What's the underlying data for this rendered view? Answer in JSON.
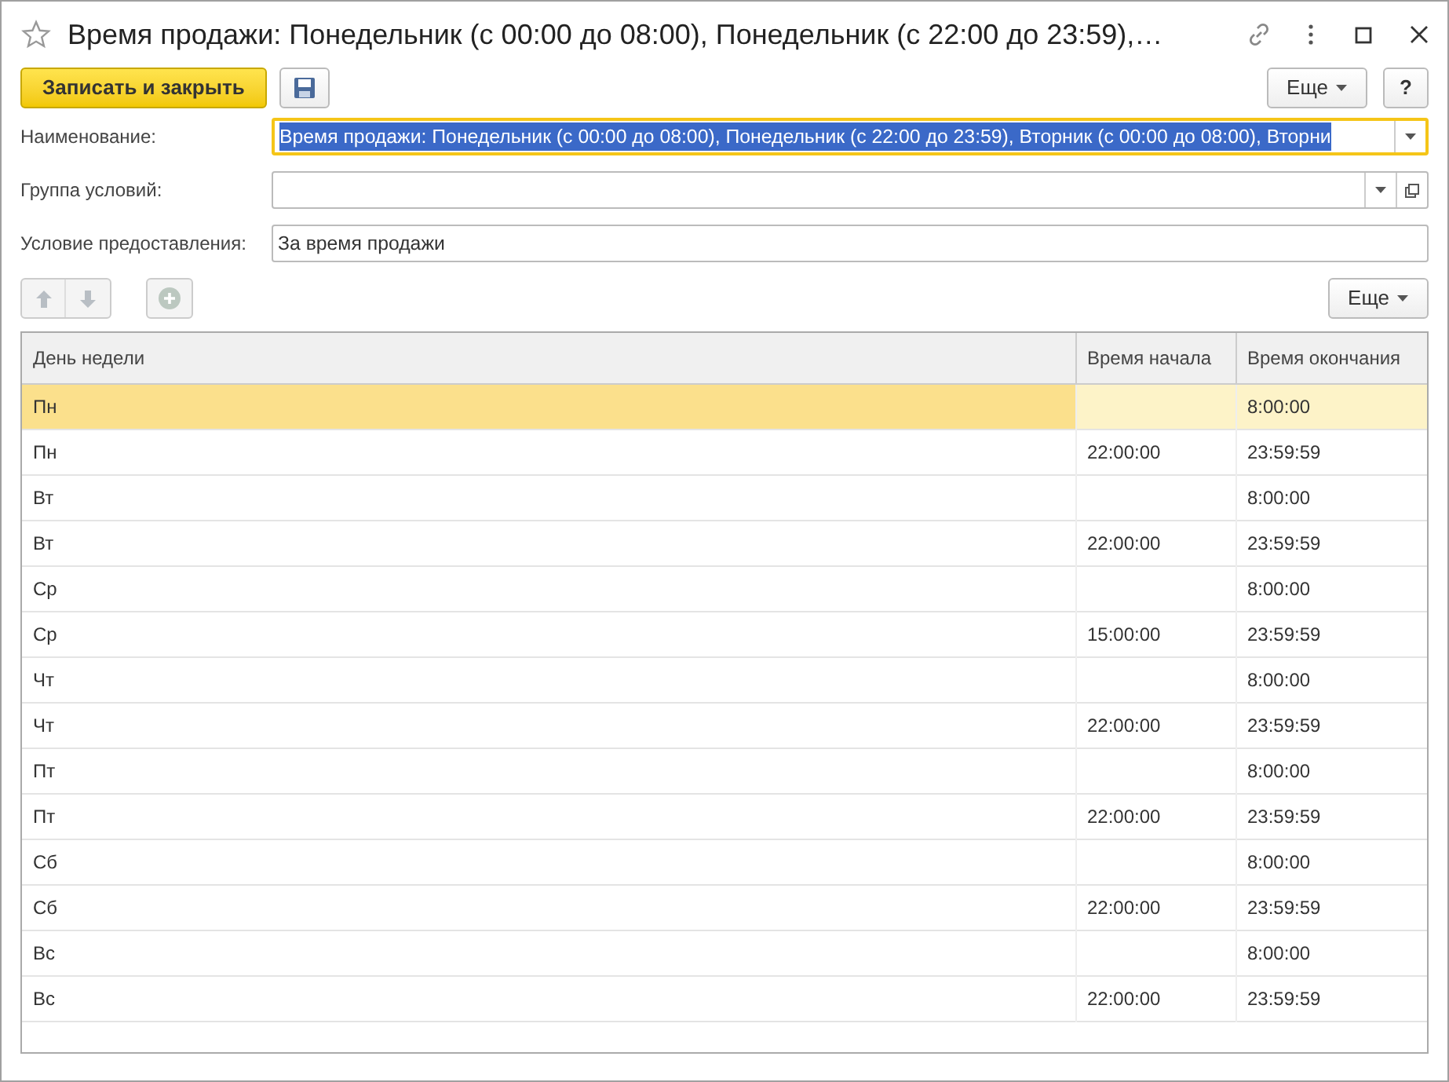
{
  "window": {
    "title": "Время продажи: Понедельник (с 00:00 до 08:00), Понедельник (с 22:00 до 23:59),…",
    "favorite": false
  },
  "toolbar": {
    "save_close": "Записать и закрыть",
    "more": "Еще",
    "help": "?"
  },
  "fields": [
    {
      "kind": "combo",
      "label": "Наименование:",
      "value": "Время продажи: Понедельник (с 00:00 до 08:00), Понедельник (с 22:00 до 23:59), Вторник (с 00:00 до 08:00), Вторни",
      "focused": true
    },
    {
      "kind": "ref",
      "label": "Группа условий:",
      "focused": false
    },
    {
      "kind": "text",
      "label": "Условие предоставления:",
      "value": "За время продажи",
      "focused": false
    }
  ],
  "table_toolbar": {
    "more": "Еще"
  },
  "table": {
    "columns": [
      "День недели",
      "Время начала",
      "Время окончания"
    ],
    "rows": [
      {
        "cells": [
          "Пн",
          "",
          "8:00:00"
        ],
        "selected": true
      },
      {
        "cells": [
          "Пн",
          "22:00:00",
          "23:59:59"
        ],
        "selected": false
      },
      {
        "cells": [
          "Вт",
          "",
          "8:00:00"
        ],
        "selected": false
      },
      {
        "cells": [
          "Вт",
          "22:00:00",
          "23:59:59"
        ],
        "selected": false
      },
      {
        "cells": [
          "Ср",
          "",
          "8:00:00"
        ],
        "selected": false
      },
      {
        "cells": [
          "Ср",
          "15:00:00",
          "23:59:59"
        ],
        "selected": false
      },
      {
        "cells": [
          "Чт",
          "",
          "8:00:00"
        ],
        "selected": false
      },
      {
        "cells": [
          "Чт",
          "22:00:00",
          "23:59:59"
        ],
        "selected": false
      },
      {
        "cells": [
          "Пт",
          "",
          "8:00:00"
        ],
        "selected": false
      },
      {
        "cells": [
          "Пт",
          "22:00:00",
          "23:59:59"
        ],
        "selected": false
      },
      {
        "cells": [
          "Сб",
          "",
          "8:00:00"
        ],
        "selected": false
      },
      {
        "cells": [
          "Сб",
          "22:00:00",
          "23:59:59"
        ],
        "selected": false
      },
      {
        "cells": [
          "Вс",
          "",
          "8:00:00"
        ],
        "selected": false
      },
      {
        "cells": [
          "Вс",
          "22:00:00",
          "23:59:59"
        ],
        "selected": false
      }
    ]
  }
}
